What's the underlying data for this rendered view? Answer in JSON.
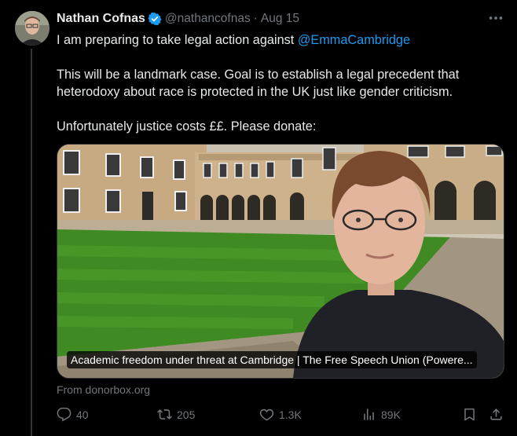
{
  "tweet": {
    "author_name": "Nathan Cofnas",
    "handle": "@nathancofnas",
    "separator": "·",
    "date": "Aug 15",
    "line1_prefix": "I am preparing to take legal action against ",
    "line1_mention": "@EmmaCambridge",
    "paragraph2": "This will be a landmark case. Goal is to establish a legal precedent that heterodoxy about race is protected in the UK just like gender criticism.",
    "paragraph3": "Unfortunately justice costs ££. Please donate:"
  },
  "card": {
    "caption": "Academic freedom under threat at Cambridge | The Free Speech Union (Powere...",
    "source": "From donorbox.org"
  },
  "actions": {
    "replies": "40",
    "reposts": "205",
    "likes": "1.3K",
    "views": "89K"
  },
  "colors": {
    "background": "#000000",
    "text": "#e7e9ea",
    "muted": "#71767b",
    "accent": "#1d9bf0"
  },
  "icons": [
    "verified-badge-icon",
    "more-icon",
    "reply-icon",
    "repost-icon",
    "like-icon",
    "views-icon",
    "bookmark-icon",
    "share-icon"
  ]
}
